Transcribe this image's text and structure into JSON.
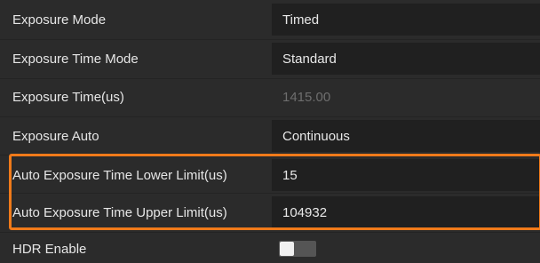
{
  "properties": [
    {
      "label": "Exposure Mode",
      "value": "Timed"
    },
    {
      "label": "Exposure Time Mode",
      "value": "Standard"
    },
    {
      "label": "Exposure Time(us)",
      "value": "1415.00"
    },
    {
      "label": "Exposure Auto",
      "value": "Continuous"
    },
    {
      "label": "Auto Exposure Time Lower Limit(us)",
      "value": "15"
    },
    {
      "label": "Auto Exposure Time Upper Limit(us)",
      "value": "104932"
    },
    {
      "label": "HDR Enable",
      "value_state": "off"
    }
  ],
  "colors": {
    "highlight": "#f07a1a",
    "background": "#2b2b2b",
    "field": "#202020"
  }
}
